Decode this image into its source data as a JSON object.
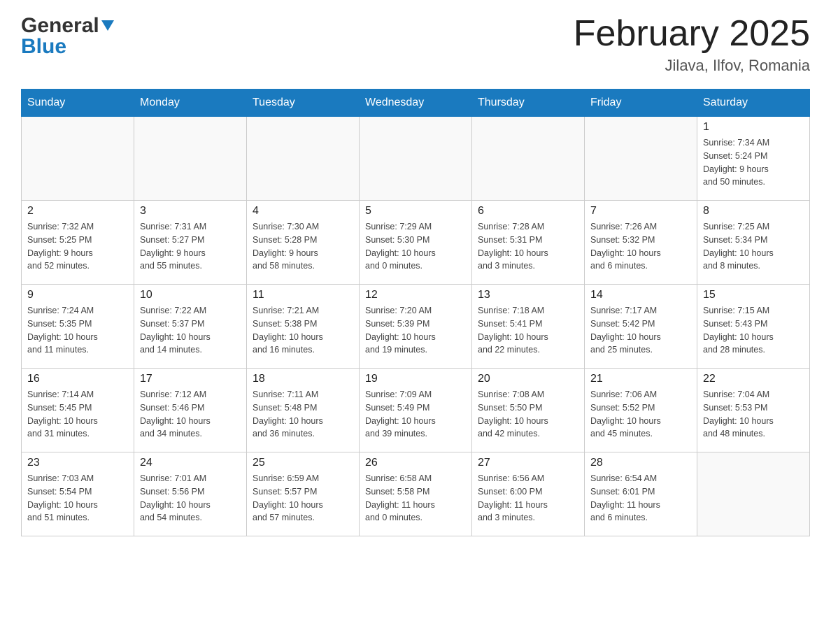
{
  "logo": {
    "general": "General",
    "blue": "Blue",
    "triangle": "▲"
  },
  "title": "February 2025",
  "location": "Jilava, Ilfov, Romania",
  "weekdays": [
    "Sunday",
    "Monday",
    "Tuesday",
    "Wednesday",
    "Thursday",
    "Friday",
    "Saturday"
  ],
  "weeks": [
    [
      {
        "day": "",
        "info": ""
      },
      {
        "day": "",
        "info": ""
      },
      {
        "day": "",
        "info": ""
      },
      {
        "day": "",
        "info": ""
      },
      {
        "day": "",
        "info": ""
      },
      {
        "day": "",
        "info": ""
      },
      {
        "day": "1",
        "info": "Sunrise: 7:34 AM\nSunset: 5:24 PM\nDaylight: 9 hours\nand 50 minutes."
      }
    ],
    [
      {
        "day": "2",
        "info": "Sunrise: 7:32 AM\nSunset: 5:25 PM\nDaylight: 9 hours\nand 52 minutes."
      },
      {
        "day": "3",
        "info": "Sunrise: 7:31 AM\nSunset: 5:27 PM\nDaylight: 9 hours\nand 55 minutes."
      },
      {
        "day": "4",
        "info": "Sunrise: 7:30 AM\nSunset: 5:28 PM\nDaylight: 9 hours\nand 58 minutes."
      },
      {
        "day": "5",
        "info": "Sunrise: 7:29 AM\nSunset: 5:30 PM\nDaylight: 10 hours\nand 0 minutes."
      },
      {
        "day": "6",
        "info": "Sunrise: 7:28 AM\nSunset: 5:31 PM\nDaylight: 10 hours\nand 3 minutes."
      },
      {
        "day": "7",
        "info": "Sunrise: 7:26 AM\nSunset: 5:32 PM\nDaylight: 10 hours\nand 6 minutes."
      },
      {
        "day": "8",
        "info": "Sunrise: 7:25 AM\nSunset: 5:34 PM\nDaylight: 10 hours\nand 8 minutes."
      }
    ],
    [
      {
        "day": "9",
        "info": "Sunrise: 7:24 AM\nSunset: 5:35 PM\nDaylight: 10 hours\nand 11 minutes."
      },
      {
        "day": "10",
        "info": "Sunrise: 7:22 AM\nSunset: 5:37 PM\nDaylight: 10 hours\nand 14 minutes."
      },
      {
        "day": "11",
        "info": "Sunrise: 7:21 AM\nSunset: 5:38 PM\nDaylight: 10 hours\nand 16 minutes."
      },
      {
        "day": "12",
        "info": "Sunrise: 7:20 AM\nSunset: 5:39 PM\nDaylight: 10 hours\nand 19 minutes."
      },
      {
        "day": "13",
        "info": "Sunrise: 7:18 AM\nSunset: 5:41 PM\nDaylight: 10 hours\nand 22 minutes."
      },
      {
        "day": "14",
        "info": "Sunrise: 7:17 AM\nSunset: 5:42 PM\nDaylight: 10 hours\nand 25 minutes."
      },
      {
        "day": "15",
        "info": "Sunrise: 7:15 AM\nSunset: 5:43 PM\nDaylight: 10 hours\nand 28 minutes."
      }
    ],
    [
      {
        "day": "16",
        "info": "Sunrise: 7:14 AM\nSunset: 5:45 PM\nDaylight: 10 hours\nand 31 minutes."
      },
      {
        "day": "17",
        "info": "Sunrise: 7:12 AM\nSunset: 5:46 PM\nDaylight: 10 hours\nand 34 minutes."
      },
      {
        "day": "18",
        "info": "Sunrise: 7:11 AM\nSunset: 5:48 PM\nDaylight: 10 hours\nand 36 minutes."
      },
      {
        "day": "19",
        "info": "Sunrise: 7:09 AM\nSunset: 5:49 PM\nDaylight: 10 hours\nand 39 minutes."
      },
      {
        "day": "20",
        "info": "Sunrise: 7:08 AM\nSunset: 5:50 PM\nDaylight: 10 hours\nand 42 minutes."
      },
      {
        "day": "21",
        "info": "Sunrise: 7:06 AM\nSunset: 5:52 PM\nDaylight: 10 hours\nand 45 minutes."
      },
      {
        "day": "22",
        "info": "Sunrise: 7:04 AM\nSunset: 5:53 PM\nDaylight: 10 hours\nand 48 minutes."
      }
    ],
    [
      {
        "day": "23",
        "info": "Sunrise: 7:03 AM\nSunset: 5:54 PM\nDaylight: 10 hours\nand 51 minutes."
      },
      {
        "day": "24",
        "info": "Sunrise: 7:01 AM\nSunset: 5:56 PM\nDaylight: 10 hours\nand 54 minutes."
      },
      {
        "day": "25",
        "info": "Sunrise: 6:59 AM\nSunset: 5:57 PM\nDaylight: 10 hours\nand 57 minutes."
      },
      {
        "day": "26",
        "info": "Sunrise: 6:58 AM\nSunset: 5:58 PM\nDaylight: 11 hours\nand 0 minutes."
      },
      {
        "day": "27",
        "info": "Sunrise: 6:56 AM\nSunset: 6:00 PM\nDaylight: 11 hours\nand 3 minutes."
      },
      {
        "day": "28",
        "info": "Sunrise: 6:54 AM\nSunset: 6:01 PM\nDaylight: 11 hours\nand 6 minutes."
      },
      {
        "day": "",
        "info": ""
      }
    ]
  ]
}
